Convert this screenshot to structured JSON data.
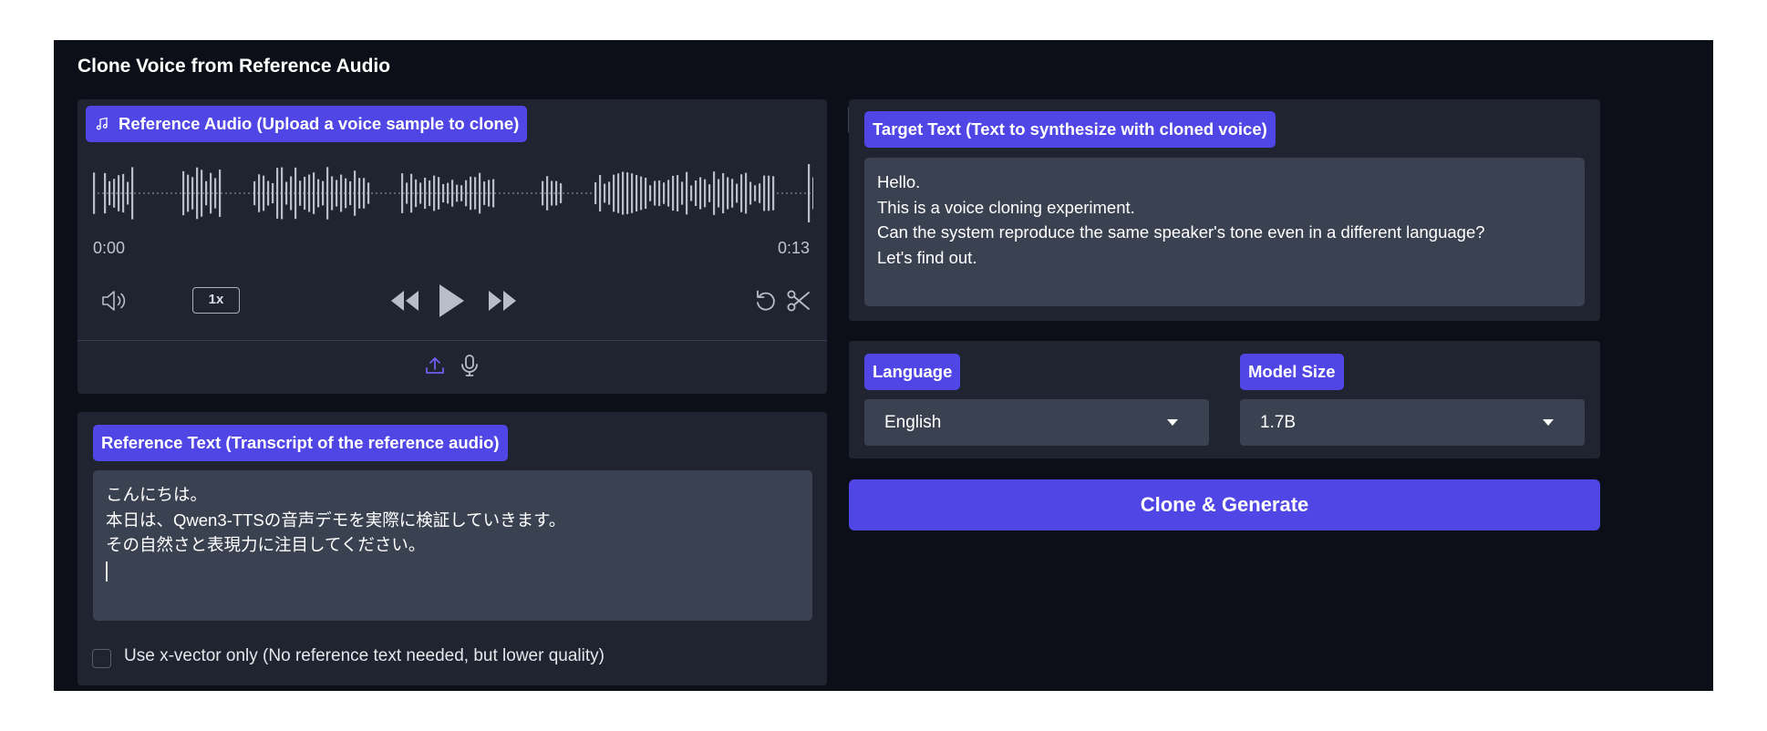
{
  "app": {
    "title": "Clone Voice from Reference Audio"
  },
  "reference_audio": {
    "label": "Reference Audio (Upload a voice sample to clone)",
    "current_time": "0:00",
    "duration": "0:13",
    "speed": "1x"
  },
  "reference_text": {
    "label": "Reference Text (Transcript of the reference audio)",
    "lines": [
      "こんにちは。",
      "本日は、Qwen3-TTSの音声デモを実際に検証していきます。",
      "その自然さと表現力に注目してください。"
    ]
  },
  "xvector": {
    "label": "Use x-vector only (No reference text needed, but lower quality)",
    "checked": false
  },
  "target_text": {
    "label": "Target Text (Text to synthesize with cloned voice)",
    "lines": [
      "Hello.",
      "This is a voice cloning experiment.",
      "Can the system reproduce the same speaker's tone even in a different language?",
      "Let's find out."
    ]
  },
  "language": {
    "label": "Language",
    "value": "English"
  },
  "model_size": {
    "label": "Model Size",
    "value": "1.7B"
  },
  "generate_button": {
    "label": "Clone & Generate"
  },
  "colors": {
    "accent": "#4f46e5",
    "background": "#0c0f17",
    "panel": "#1f2430",
    "input": "#3a4150"
  },
  "icons": [
    "music-note-icon",
    "close-icon",
    "volume-icon",
    "rewind-icon",
    "play-icon",
    "fast-forward-icon",
    "reset-icon",
    "scissors-icon",
    "upload-icon",
    "microphone-icon",
    "dropdown-caret-icon"
  ]
}
